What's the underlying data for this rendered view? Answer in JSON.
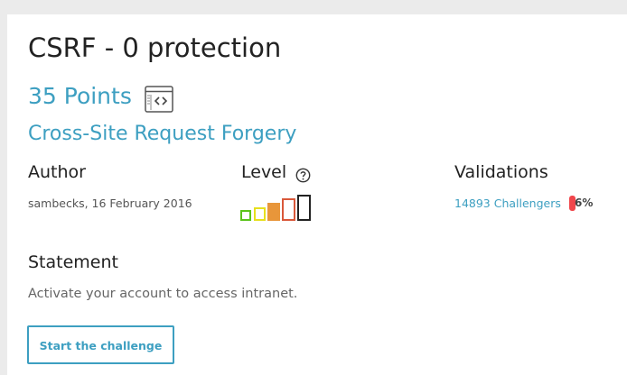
{
  "challenge": {
    "title": "CSRF - 0 protection",
    "points": "35 Points",
    "points_icon": "web-client-icon",
    "category": "Cross-Site Request Forgery"
  },
  "author": {
    "heading": "Author",
    "info": "sambecks,  16 February 2016"
  },
  "level": {
    "heading": "Level",
    "help_icon": "question-circle-icon",
    "value": 3,
    "max": 5,
    "colors": [
      "#5ac31a",
      "#e6e01e",
      "#e8963a",
      "#d9583a",
      "#222222"
    ]
  },
  "validations": {
    "heading": "Validations",
    "challengers": "14893 Challengers",
    "percent": "6%",
    "bar_color": "#f0464b"
  },
  "statement": {
    "heading": "Statement",
    "text": "Activate your account to access intranet."
  },
  "actions": {
    "start_label": "Start the challenge"
  }
}
